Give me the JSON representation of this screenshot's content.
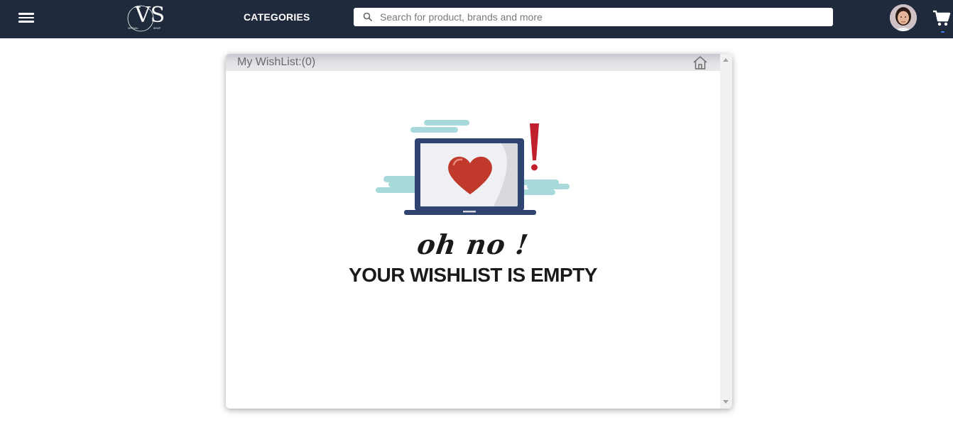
{
  "header": {
    "logo_text": "VS",
    "logo_subtext_left": "VIRTUAL",
    "logo_subtext_right": "SHOP",
    "categories_label": "CATEGORIES",
    "search_placeholder": "Search for product, brands and more",
    "bar_color": "#1f2a3c"
  },
  "wishlist": {
    "title": "My WishList:(0)",
    "exclamation": "oh no !",
    "empty_message": "YOUR WISHLIST IS EMPTY",
    "illustration": "laptop-heart-illustration",
    "heart_color": "#c0392b",
    "exclaim_color": "#c0202d"
  },
  "icons": {
    "menu": "hamburger-menu-icon",
    "search": "search-icon",
    "cart": "cart-icon",
    "home": "home-icon"
  }
}
